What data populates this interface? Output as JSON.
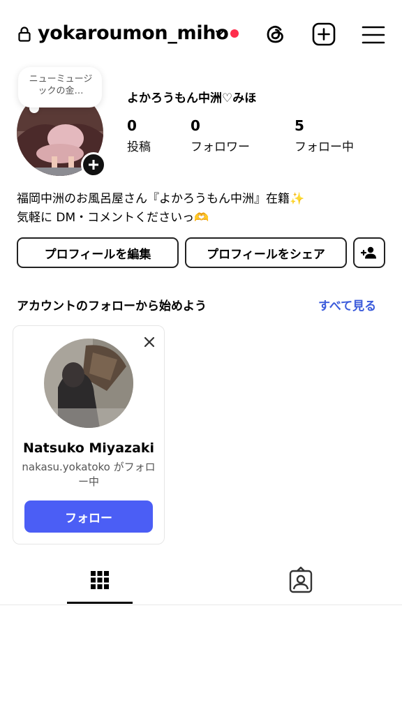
{
  "header": {
    "username": "yokaroumon_miho",
    "icons": [
      "lock-icon",
      "chevron-down-icon",
      "threads-icon",
      "add-post-icon",
      "menu-icon"
    ],
    "notification_color": "#ff2d4c"
  },
  "profile": {
    "note": "ニューミュージックの金…",
    "display_name": "よかろうもん中洲♡みほ",
    "stats": {
      "posts_count": "0",
      "posts_label": "投稿",
      "followers_count": "0",
      "followers_label": "フォロワー",
      "following_count": "5",
      "following_label": "フォロー中"
    },
    "bio_line1": "福岡中洲のお風呂屋さん『よかろうもん中洲』在籍✨",
    "bio_line2": "気軽に DM・コメントくださいっ🫶"
  },
  "actions": {
    "edit_label": "プロフィールを編集",
    "share_label": "プロフィールをシェア"
  },
  "suggestions": {
    "title": "アカウントのフォローから始めよう",
    "see_all": "すべて見る",
    "card": {
      "name": "Natsuko Miyazaki",
      "subtitle": "nakasu.yokatoko がフォロー中",
      "follow_label": "フォロー"
    }
  },
  "tabs": [
    "grid-icon",
    "tagged-icon"
  ],
  "colors": {
    "accent": "#4b5ef5",
    "link": "#3b5bdb"
  }
}
